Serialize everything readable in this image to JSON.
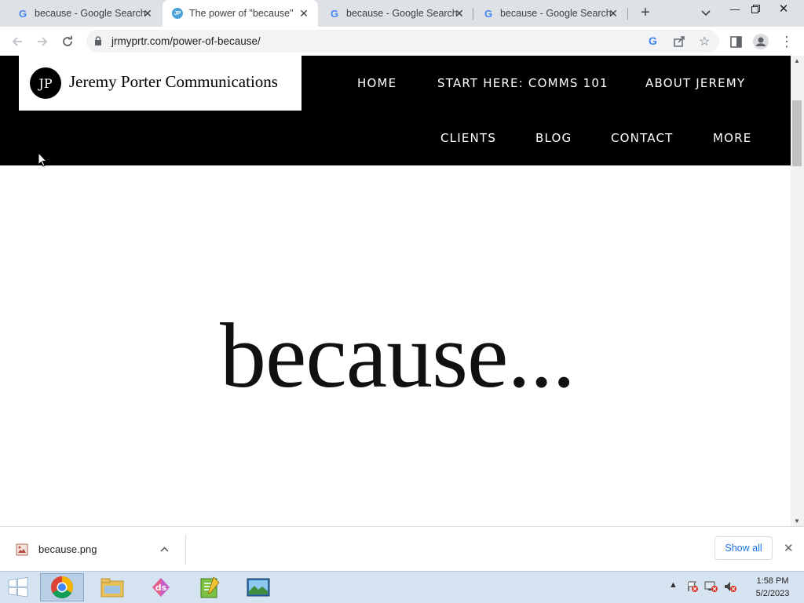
{
  "browser": {
    "tabs": [
      {
        "title": "because - Google Search",
        "favicon": "google-icon",
        "active": false
      },
      {
        "title": "The power of \"because\"",
        "favicon": "jp-favicon",
        "active": true
      },
      {
        "title": "because - Google Search",
        "favicon": "google-icon",
        "active": false
      },
      {
        "title": "because - Google Search",
        "favicon": "google-icon",
        "active": false
      }
    ],
    "url": "jrmyprtr.com/power-of-because/"
  },
  "site": {
    "logo_initials": "JP",
    "logo_name": "Jeremy Porter Communications",
    "nav": [
      "HOME",
      "START HERE: COMMS 101",
      "ABOUT JEREMY",
      "CLIENTS",
      "BLOG",
      "CONTACT",
      "MORE"
    ],
    "hero_text": "because..."
  },
  "downloads": {
    "file_name": "because.png",
    "show_all_label": "Show all"
  },
  "taskbar": {
    "time": "1:58 PM",
    "date": "5/2/2023"
  },
  "colors": {
    "header_bg": "#000000",
    "tabstrip_bg": "#dee1e6",
    "link_blue": "#1a73e8"
  }
}
